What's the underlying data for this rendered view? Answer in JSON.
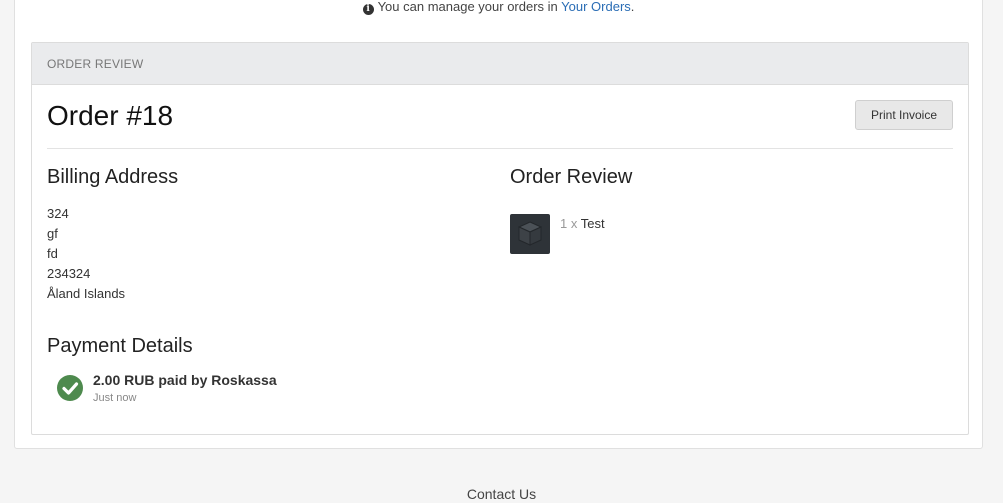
{
  "notice": {
    "prefix": "You can manage your orders in",
    "link": "Your Orders",
    "suffix": "."
  },
  "review_header": "ORDER REVIEW",
  "order": {
    "title": "Order #18",
    "print_label": "Print Invoice"
  },
  "billing": {
    "title": "Billing Address",
    "lines": [
      "324",
      "gf",
      "fd",
      "234324",
      "Åland Islands"
    ]
  },
  "order_review": {
    "title": "Order Review",
    "items": [
      {
        "qty": "1 x",
        "name": "Test",
        "icon": "product-box-icon"
      }
    ]
  },
  "payment": {
    "title": "Payment Details",
    "text": "2.00 RUB paid by Roskassa",
    "time": "Just now",
    "status_icon": "check-circle-icon",
    "status_color": "#4e8a4e"
  },
  "footer": {
    "contact": "Contact Us"
  },
  "colors": {
    "link": "#2a6db5",
    "header_bg": "#eaebed"
  }
}
